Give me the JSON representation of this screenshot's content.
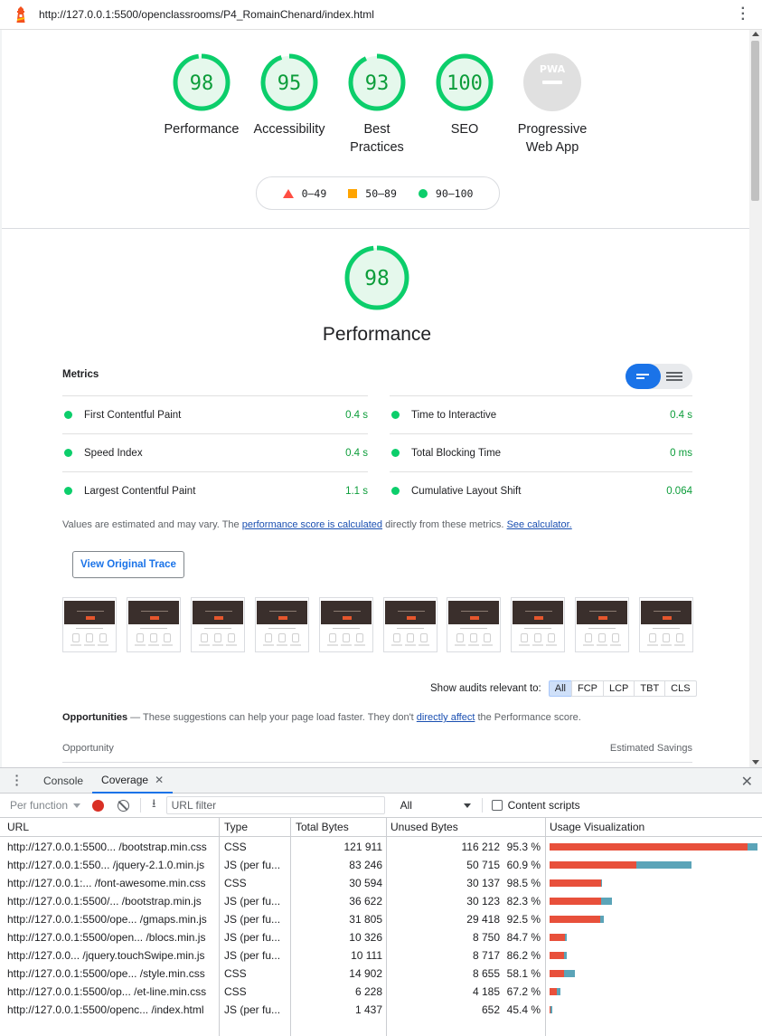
{
  "browser": {
    "url": "http://127.0.0.1:5500/openclassrooms/P4_RomainChenard/index.html"
  },
  "colors": {
    "pass": "#0cce6b",
    "pass_text": "#0c9d3a",
    "average": "#ffa400",
    "fail": "#ff4e42",
    "unused": "#e8503b",
    "used": "#5ba4b8",
    "accent": "#1a73e8"
  },
  "categories": [
    {
      "score": "98",
      "label": "Performance",
      "fraction": 0.98
    },
    {
      "score": "95",
      "label": "Accessibility",
      "fraction": 0.95
    },
    {
      "score": "93",
      "label": "Best\nPractices",
      "fraction": 0.93
    },
    {
      "score": "100",
      "label": "SEO",
      "fraction": 1.0
    },
    {
      "score": "PWA",
      "label": "Progressive\nWeb App",
      "fraction": null
    }
  ],
  "legend": {
    "fail": "0–49",
    "average": "50–89",
    "pass": "90–100"
  },
  "performance": {
    "score": "98",
    "score_fraction": 0.98,
    "title": "Performance",
    "metrics_heading": "Metrics",
    "metrics": [
      {
        "name": "First Contentful Paint",
        "value": "0.4 s"
      },
      {
        "name": "Time to Interactive",
        "value": "0.4 s"
      },
      {
        "name": "Speed Index",
        "value": "0.4 s"
      },
      {
        "name": "Total Blocking Time",
        "value": "0 ms"
      },
      {
        "name": "Largest Contentful Paint",
        "value": "1.1 s"
      },
      {
        "name": "Cumulative Layout Shift",
        "value": "0.064"
      }
    ],
    "note": {
      "prefix": "Values are estimated and may vary. The ",
      "link1": "performance score is calculated",
      "middle": " directly from these metrics. ",
      "link2": "See calculator."
    },
    "trace_button": "View Original Trace",
    "filter": {
      "label": "Show audits relevant to:",
      "chips": [
        "All",
        "FCP",
        "LCP",
        "TBT",
        "CLS"
      ]
    },
    "opportunities": {
      "title": "Opportunities",
      "dash": " — ",
      "text1": "These suggestions can help your page load faster. They don't ",
      "link": "directly affect",
      "text2": " the Performance score.",
      "col_left": "Opportunity",
      "col_right": "Estimated Savings"
    }
  },
  "drawer": {
    "tabs": [
      "Console",
      "Coverage"
    ],
    "active_tab": "Coverage",
    "toolbar": {
      "mode": "Per function",
      "filter_placeholder": "URL filter",
      "type_select": "All",
      "content_scripts": "Content scripts"
    },
    "table": {
      "headers": [
        "URL",
        "Type",
        "Total Bytes",
        "Unused Bytes",
        "Usage Visualization"
      ],
      "rows": [
        {
          "url": "http://127.0.0.1:5500... /bootstrap.min.css",
          "type": "CSS",
          "total": "121 911",
          "unused": "116 212",
          "pct": "95.3 %",
          "total_bytes": 121911,
          "unused_bytes": 116212
        },
        {
          "url": "http://127.0.0.1:550... /jquery-2.1.0.min.js",
          "type": "JS (per fu...",
          "total": "83 246",
          "unused": "50 715",
          "pct": "60.9 %",
          "total_bytes": 83246,
          "unused_bytes": 50715
        },
        {
          "url": "http://127.0.0.1:... /font-awesome.min.css",
          "type": "CSS",
          "total": "30 594",
          "unused": "30 137",
          "pct": "98.5 %",
          "total_bytes": 30594,
          "unused_bytes": 30137
        },
        {
          "url": "http://127.0.0.1:5500/... /bootstrap.min.js",
          "type": "JS (per fu...",
          "total": "36 622",
          "unused": "30 123",
          "pct": "82.3 %",
          "total_bytes": 36622,
          "unused_bytes": 30123
        },
        {
          "url": "http://127.0.0.1:5500/ope... /gmaps.min.js",
          "type": "JS (per fu...",
          "total": "31 805",
          "unused": "29 418",
          "pct": "92.5 %",
          "total_bytes": 31805,
          "unused_bytes": 29418
        },
        {
          "url": "http://127.0.0.1:5500/open... /blocs.min.js",
          "type": "JS (per fu...",
          "total": "10 326",
          "unused": "8 750",
          "pct": "84.7 %",
          "total_bytes": 10326,
          "unused_bytes": 8750
        },
        {
          "url": "http://127.0.0... /jquery.touchSwipe.min.js",
          "type": "JS (per fu...",
          "total": "10 111",
          "unused": "8 717",
          "pct": "86.2 %",
          "total_bytes": 10111,
          "unused_bytes": 8717
        },
        {
          "url": "http://127.0.0.1:5500/ope... /style.min.css",
          "type": "CSS",
          "total": "14 902",
          "unused": "8 655",
          "pct": "58.1 %",
          "total_bytes": 14902,
          "unused_bytes": 8655
        },
        {
          "url": "http://127.0.0.1:5500/op... /et-line.min.css",
          "type": "CSS",
          "total": "6 228",
          "unused": "4 185",
          "pct": "67.2 %",
          "total_bytes": 6228,
          "unused_bytes": 4185
        },
        {
          "url": "http://127.0.0.1:5500/openc... /index.html",
          "type": "JS (per fu...",
          "total": "1 437",
          "unused": "652",
          "pct": "45.4 %",
          "total_bytes": 1437,
          "unused_bytes": 652
        }
      ]
    }
  }
}
